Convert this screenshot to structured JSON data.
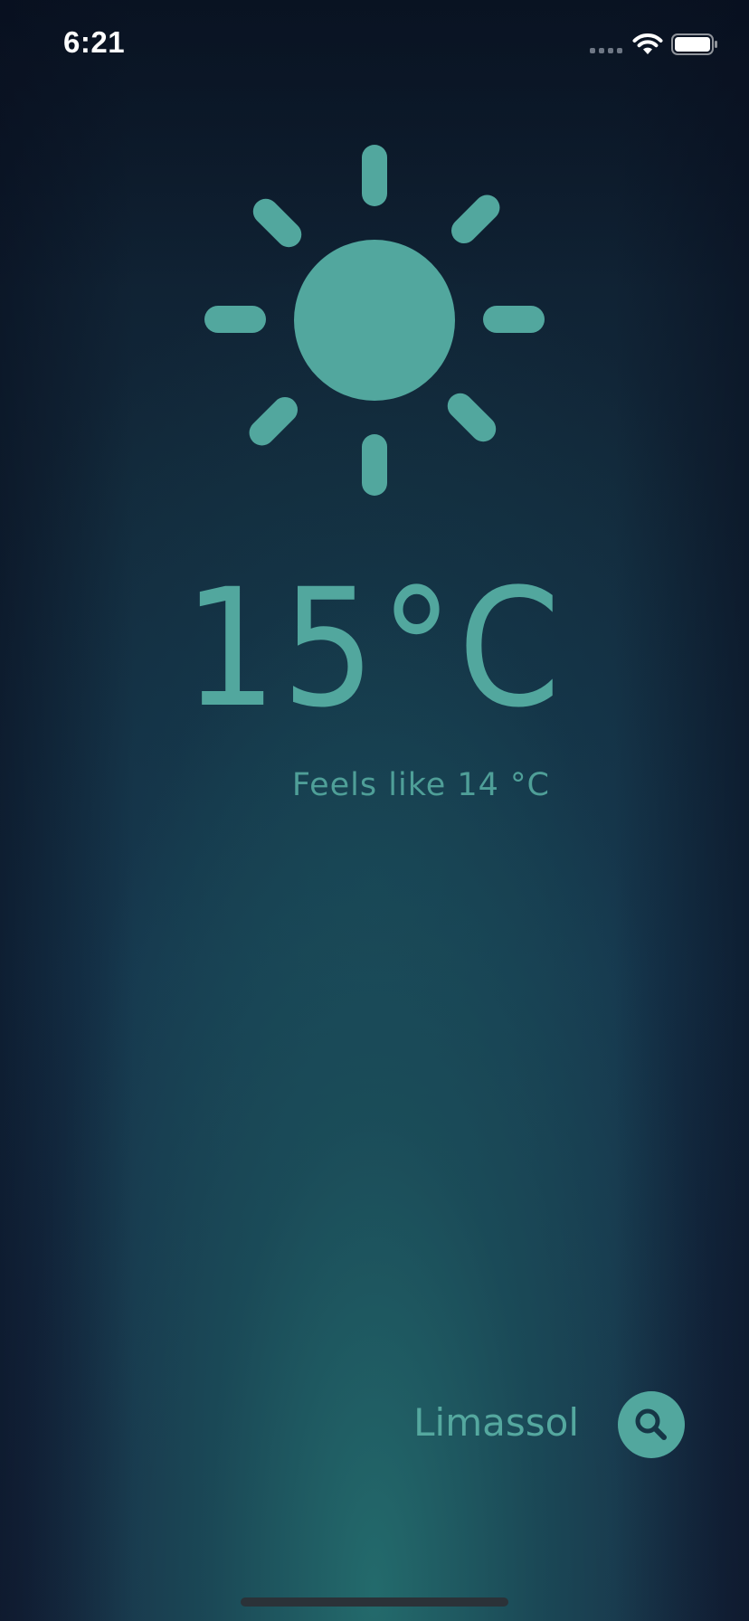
{
  "status_bar": {
    "time": "6:21",
    "signal_icon": "cellular-signal-icon",
    "wifi_icon": "wifi-icon",
    "battery_icon": "battery-icon"
  },
  "weather": {
    "condition_icon": "sun-icon",
    "temperature": "15°C",
    "feels_like": "Feels like 14 °C"
  },
  "location": {
    "city": "Limassol",
    "search_icon": "search-icon"
  },
  "colors": {
    "accent": "#52a79e",
    "background_top": "#0d1b2c",
    "background_glow": "#246e6e"
  }
}
